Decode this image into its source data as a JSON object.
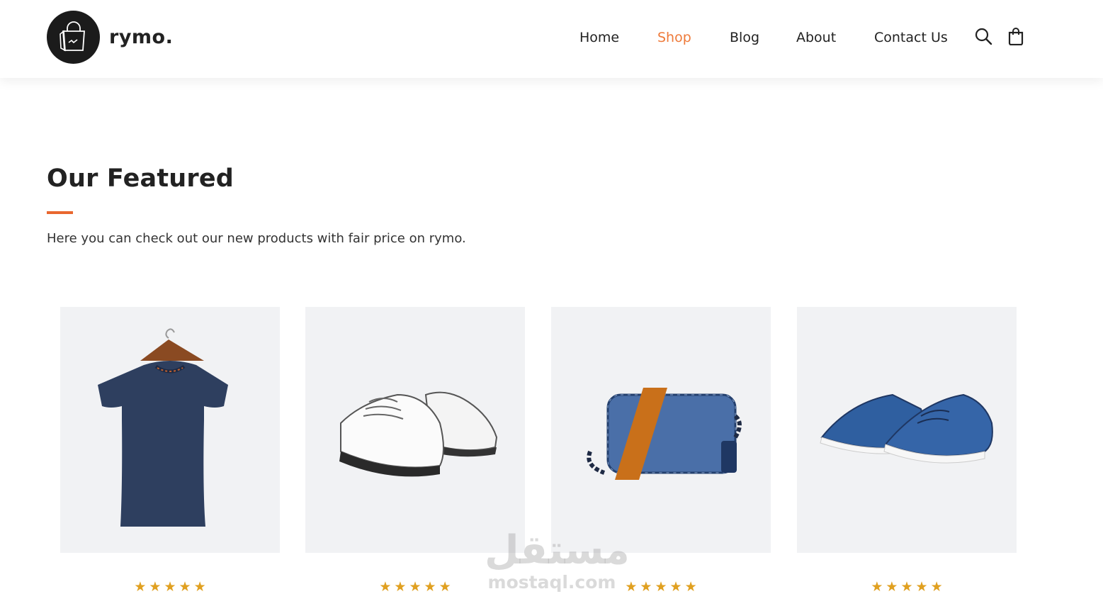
{
  "brand": {
    "name": "rymo.",
    "logo_icon": "shopping-bag-icon"
  },
  "nav": {
    "items": [
      {
        "label": "Home",
        "active": false
      },
      {
        "label": "Shop",
        "active": true
      },
      {
        "label": "Blog",
        "active": false
      },
      {
        "label": "About",
        "active": false
      },
      {
        "label": "Contact Us",
        "active": false
      }
    ],
    "search_icon": "search-icon",
    "cart_icon": "cart-icon"
  },
  "featured": {
    "title": "Our Featured",
    "description": "Here you can check out our new products with fair price on rymo."
  },
  "products": [
    {
      "image": "navy-t-shirt",
      "rating": 5
    },
    {
      "image": "white-sneakers",
      "rating": 5
    },
    {
      "image": "blue-crossbody-bag",
      "rating": 5
    },
    {
      "image": "blue-canvas-shoes",
      "rating": 5
    }
  ],
  "watermark": {
    "arabic": "مستقل",
    "latin": "mostaql.com"
  },
  "colors": {
    "accent": "#ee7a3a",
    "underline": "#e9672f",
    "star": "#e0a020",
    "card_bg": "#f1f2f4",
    "logo_bg": "#1b1b1b"
  }
}
